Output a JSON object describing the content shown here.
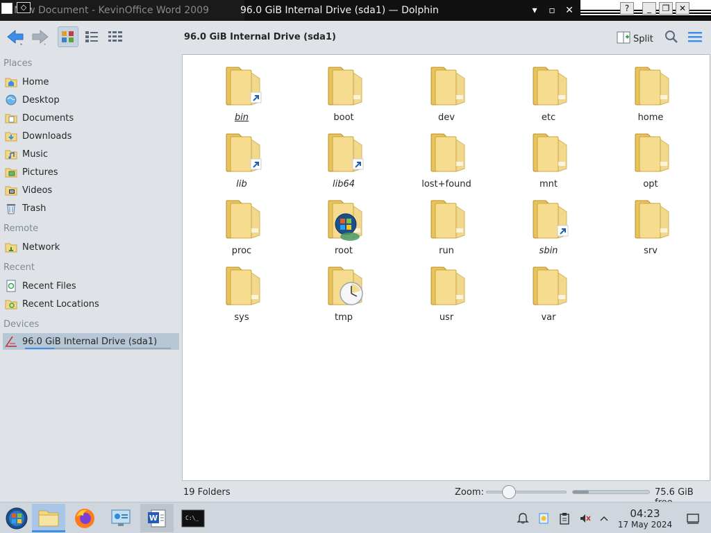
{
  "window": {
    "background_title": "New Document - KevinOffice Word 2009",
    "title": "96.0 GiB Internal Drive (sda1) — Dolphin",
    "minimize_icon": "minimize-icon",
    "maximize_icon": "maximize-icon",
    "close_icon": "close-icon"
  },
  "toolbar": {
    "location": "96.0 GiB Internal Drive (sda1)",
    "split_label": "Split"
  },
  "sidebar": {
    "places_header": "Places",
    "places": [
      {
        "label": "Home",
        "icon": "home-folder-icon"
      },
      {
        "label": "Desktop",
        "icon": "desktop-icon"
      },
      {
        "label": "Documents",
        "icon": "documents-folder-icon"
      },
      {
        "label": "Downloads",
        "icon": "downloads-folder-icon"
      },
      {
        "label": "Music",
        "icon": "music-folder-icon"
      },
      {
        "label": "Pictures",
        "icon": "pictures-folder-icon"
      },
      {
        "label": "Videos",
        "icon": "videos-folder-icon"
      },
      {
        "label": "Trash",
        "icon": "trash-icon"
      }
    ],
    "remote_header": "Remote",
    "remote": [
      {
        "label": "Network",
        "icon": "network-folder-icon"
      }
    ],
    "recent_header": "Recent",
    "recent": [
      {
        "label": "Recent Files",
        "icon": "recent-files-icon"
      },
      {
        "label": "Recent Locations",
        "icon": "recent-locations-icon"
      }
    ],
    "devices_header": "Devices",
    "devices": [
      {
        "label": "96.0 GiB Internal Drive (sda1)",
        "icon": "drive-icon",
        "used_fraction": 0.21
      }
    ]
  },
  "folders": [
    {
      "name": "bin",
      "link": true,
      "italic": true,
      "underline": true
    },
    {
      "name": "boot"
    },
    {
      "name": "dev"
    },
    {
      "name": "etc"
    },
    {
      "name": "home"
    },
    {
      "name": "lib",
      "link": true,
      "italic": true
    },
    {
      "name": "lib64",
      "link": true,
      "italic": true
    },
    {
      "name": "lost+found"
    },
    {
      "name": "mnt"
    },
    {
      "name": "opt"
    },
    {
      "name": "proc"
    },
    {
      "name": "root",
      "badge": "windows-logo"
    },
    {
      "name": "run"
    },
    {
      "name": "sbin",
      "link": true,
      "italic": true
    },
    {
      "name": "srv"
    },
    {
      "name": "sys"
    },
    {
      "name": "tmp",
      "badge": "clock"
    },
    {
      "name": "usr"
    },
    {
      "name": "var"
    }
  ],
  "status": {
    "count": "19 Folders",
    "zoom_label": "Zoom:",
    "zoom_level": 0.2,
    "free": "75.6 GiB free",
    "used_fraction": 0.21
  },
  "taskbar": {
    "time": "04:23",
    "date": "17 May 2024",
    "apps": [
      "start-orb-icon",
      "file-manager-icon",
      "firefox-icon",
      "control-panel-icon",
      "word-icon",
      "terminal-icon"
    ],
    "tray": [
      "notifications-icon",
      "updates-icon",
      "clipboard-icon",
      "volume-muted-icon",
      "show-hidden-icon",
      "show-desktop-icon"
    ]
  },
  "colors": {
    "accent": "#3d8ee6",
    "folder": "#f3d889",
    "selection": "#b8c7d6"
  }
}
